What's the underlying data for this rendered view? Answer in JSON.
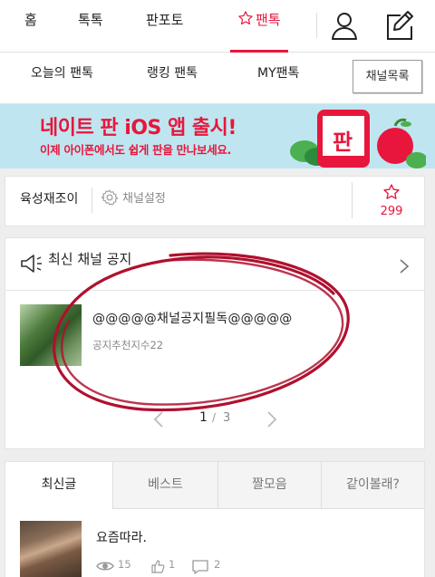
{
  "top_nav": {
    "tabs": [
      {
        "label": "홈"
      },
      {
        "label": "톡톡"
      },
      {
        "label": "판포토"
      },
      {
        "label": "팬톡",
        "active": true
      }
    ],
    "icons": [
      "user-icon",
      "compose-icon"
    ]
  },
  "sub_nav": {
    "items": [
      {
        "label": "오늘의 팬톡"
      },
      {
        "label": "랭킹 팬톡"
      },
      {
        "label": "MY팬톡"
      }
    ],
    "channel_list_button": "채널목록"
  },
  "banner": {
    "title": "네이트 판 iOS 앱 출시!",
    "subtitle": "이제 아이폰에서도 쉽게 판을 만나보세요.",
    "app_icon_text": "판"
  },
  "channel": {
    "name": "육성재조이",
    "settings_label": "채널설정",
    "star_count": "299"
  },
  "notice": {
    "heading": "최신 채널 공지",
    "post_title": "@@@@@채널공지필독@@@@@",
    "post_meta": "공지추천지수22",
    "page_current": "1",
    "page_separator": "/",
    "page_total": "3"
  },
  "posts": {
    "tabs": [
      {
        "label": "최신글",
        "active": true
      },
      {
        "label": "베스트"
      },
      {
        "label": "짤모음"
      },
      {
        "label": "같이볼래?"
      }
    ],
    "items": [
      {
        "title": "요즘따라.",
        "views": "15",
        "likes": "1",
        "comments": "2"
      }
    ]
  },
  "colors": {
    "accent": "#e8163c",
    "banner_bg": "#bfe6f0",
    "annotation": "#b0102e"
  }
}
